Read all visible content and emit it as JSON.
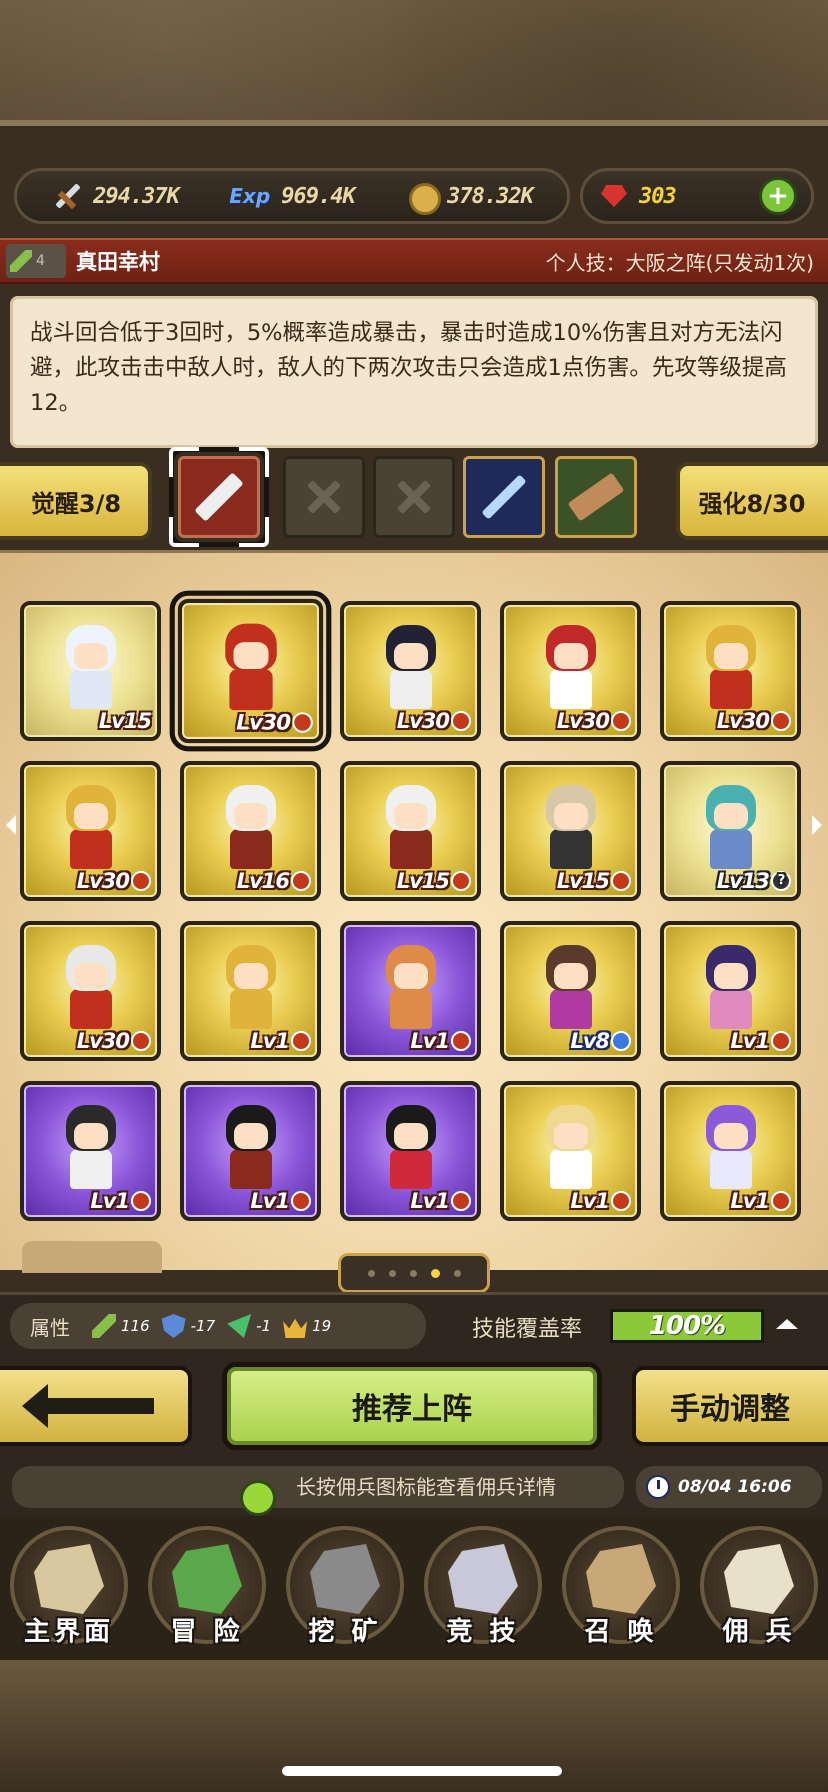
{
  "resources": {
    "attack": "294.37K",
    "exp_icon_label": "Exp",
    "exp": "969.4K",
    "coins": "378.32K",
    "gems": "303"
  },
  "skill_header": {
    "level": "4",
    "hero_name": "真田幸村",
    "personal_skill": "个人技：大阪之阵(只发动1次)"
  },
  "description": "战斗回合低于3回时，5%概率造成暴击，暴击时造成10%伤害且对方无法闪避，此攻击击中敌人时，敌人的下两次攻击只会造成1点伤害。先攻等级提高12。",
  "awakening": {
    "awaken_label": "觉醒3/8",
    "enhance_label": "强化8/30"
  },
  "heroes": [
    {
      "lv": "Lv15",
      "tier": "pale",
      "badge": "none",
      "hair": "#eef4ff",
      "cloth": "#dfe8f4"
    },
    {
      "lv": "Lv30",
      "tier": "gold",
      "badge": "dot",
      "hair": "#c0301c",
      "cloth": "#c0301c",
      "selected": true
    },
    {
      "lv": "Lv30",
      "tier": "gold",
      "badge": "dot",
      "hair": "#222233",
      "cloth": "#eeeeee"
    },
    {
      "lv": "Lv30",
      "tier": "gold",
      "badge": "dot",
      "hair": "#c02a2a",
      "cloth": "#ffffff"
    },
    {
      "lv": "Lv30",
      "tier": "gold",
      "badge": "dot",
      "hair": "#e0b43a",
      "cloth": "#c0301c"
    },
    {
      "lv": "Lv30",
      "tier": "gold",
      "badge": "dot",
      "hair": "#e0b43a",
      "cloth": "#c0301c"
    },
    {
      "lv": "Lv16",
      "tier": "gold",
      "badge": "dot",
      "hair": "#f0f0f0",
      "cloth": "#8a2a1c"
    },
    {
      "lv": "Lv15",
      "tier": "gold",
      "badge": "dot",
      "hair": "#f0f0f0",
      "cloth": "#8a2a1c"
    },
    {
      "lv": "Lv15",
      "tier": "gold",
      "badge": "dot",
      "hair": "#d8c8a8",
      "cloth": "#333333"
    },
    {
      "lv": "Lv13",
      "tier": "pale",
      "badge": "q",
      "hair": "#4ab0b0",
      "cloth": "#6a8ac8"
    },
    {
      "lv": "Lv30",
      "tier": "gold",
      "badge": "dot",
      "hair": "#e8e8e8",
      "cloth": "#c0301c"
    },
    {
      "lv": "Lv1",
      "tier": "gold",
      "badge": "dot",
      "hair": "#e0b43a",
      "cloth": "#e0b43a"
    },
    {
      "lv": "Lv1",
      "tier": "purple",
      "badge": "dot",
      "hair": "#e08a4a",
      "cloth": "#e08a4a"
    },
    {
      "lv": "Lv8",
      "tier": "gold",
      "badge": "star",
      "hair": "#5a3a2a",
      "cloth": "#b03aa0"
    },
    {
      "lv": "Lv1",
      "tier": "gold",
      "badge": "dot",
      "hair": "#3a2a6a",
      "cloth": "#e08ac0"
    },
    {
      "lv": "Lv1",
      "tier": "purple",
      "badge": "dot",
      "hair": "#2a2a2a",
      "cloth": "#f0f0f0"
    },
    {
      "lv": "Lv1",
      "tier": "purple",
      "badge": "dot",
      "hair": "#1a1a1a",
      "cloth": "#8a2a1c"
    },
    {
      "lv": "Lv1",
      "tier": "purple",
      "badge": "dot",
      "hair": "#1a1a1a",
      "cloth": "#d02a3a"
    },
    {
      "lv": "Lv1",
      "tier": "gold",
      "badge": "dot",
      "hair": "#f0d890",
      "cloth": "#ffffff"
    },
    {
      "lv": "Lv1",
      "tier": "gold",
      "badge": "dot",
      "hair": "#8a5ad8",
      "cloth": "#e8e8ff"
    }
  ],
  "attributes": {
    "label": "属性",
    "attack": "116",
    "defense": "-17",
    "agility": "-1",
    "crown": "19"
  },
  "coverage": {
    "label": "技能覆盖率",
    "value": "100%",
    "fraction": 1.0
  },
  "actions": {
    "recommend": "推荐上阵",
    "manual": "手动调整"
  },
  "tip": "长按佣兵图标能查看佣兵详情",
  "time": "08/04 16:06",
  "nav": [
    {
      "label": "主界面",
      "icon": "scroll-map-icon"
    },
    {
      "label": "冒 险",
      "icon": "island-icon"
    },
    {
      "label": "挖 矿",
      "icon": "pickaxe-icon"
    },
    {
      "label": "竞 技",
      "icon": "crossed-swords-icon"
    },
    {
      "label": "召 唤",
      "icon": "summon-scroll-icon"
    },
    {
      "label": "佣 兵",
      "icon": "tent-icon"
    }
  ],
  "pager": {
    "pages": 5,
    "current": 4
  }
}
